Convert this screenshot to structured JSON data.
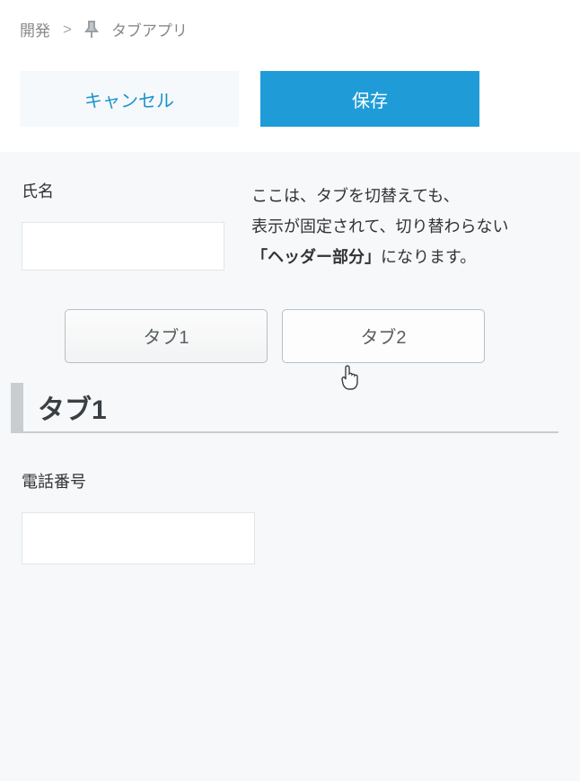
{
  "breadcrumb": {
    "root": "開発",
    "separator": ">",
    "current": "タブアプリ"
  },
  "actions": {
    "cancel_label": "キャンセル",
    "save_label": "保存"
  },
  "header": {
    "name_label": "氏名",
    "name_value": "",
    "description_line1": "ここは、タブを切替えても、",
    "description_line2": "表示が固定されて、切り替わらない",
    "description_bold": "「ヘッダー部分」",
    "description_tail": "になります。"
  },
  "tabs": {
    "tab1_label": "タブ1",
    "tab2_label": "タブ2",
    "active_title": "タブ1"
  },
  "tab1_content": {
    "phone_label": "電話番号",
    "phone_value": ""
  }
}
